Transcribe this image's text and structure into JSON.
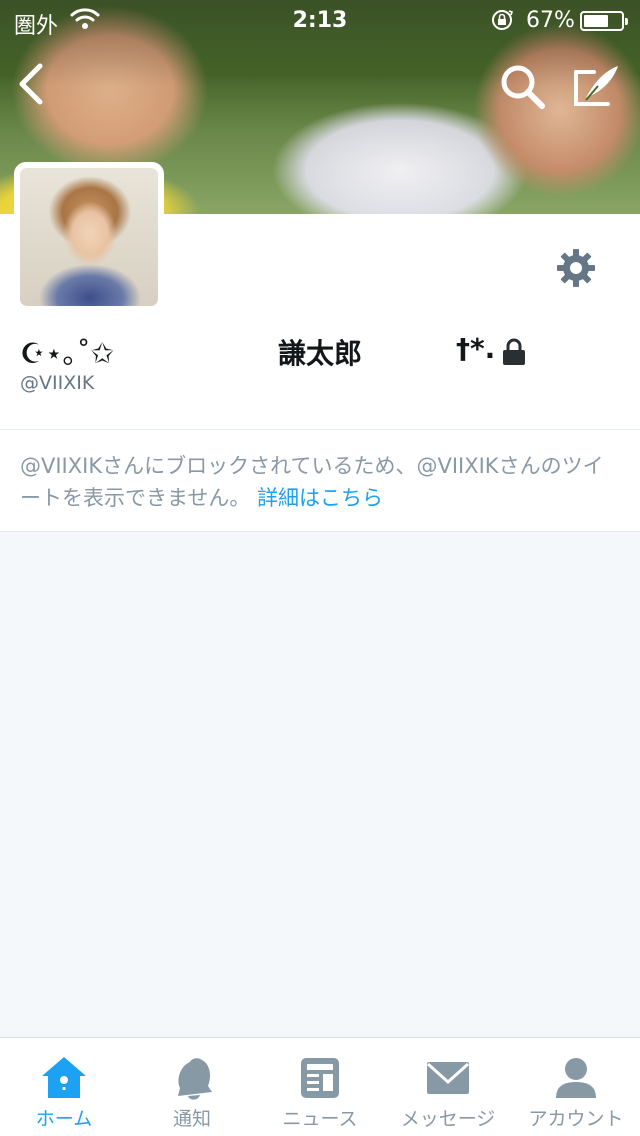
{
  "status_bar": {
    "carrier": "圏外",
    "time": "2:13",
    "battery_percent_text": "67%",
    "battery_level": 0.67
  },
  "profile": {
    "display_name_part1": "☪︎⋆｡˚✩",
    "display_name_part2": "謙太郎",
    "display_name_part3": "†*.",
    "screen_name": "@VIIXIK",
    "protected": true
  },
  "blocked_notice": {
    "message": "@VIIXIKさんにブロックされているため、@VIIXIKさんのツイートを表示できません。",
    "link_text": "詳細はこちら"
  },
  "tabs": [
    {
      "label": "ホーム",
      "icon": "home-icon",
      "active": true
    },
    {
      "label": "通知",
      "icon": "bell-icon",
      "active": false
    },
    {
      "label": "ニュース",
      "icon": "news-icon",
      "active": false
    },
    {
      "label": "メッセージ",
      "icon": "envelope-icon",
      "active": false
    },
    {
      "label": "アカウント",
      "icon": "person-icon",
      "active": false
    }
  ],
  "colors": {
    "accent": "#1da1f2",
    "inactive": "#8899a6",
    "icon_gray": "#657786"
  }
}
